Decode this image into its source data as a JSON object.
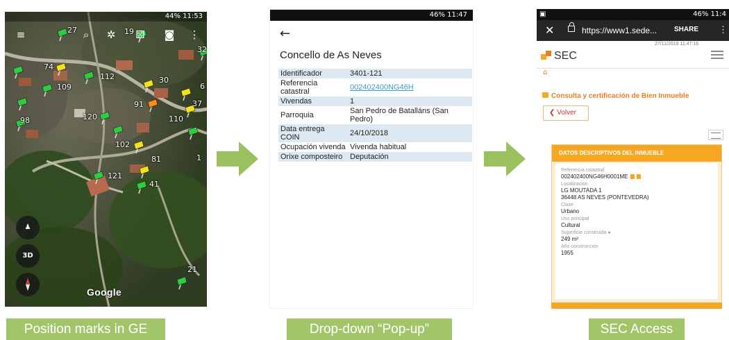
{
  "panel_ge": {
    "status": "44% 11:53",
    "pin_labels": [
      "27",
      "19",
      "32",
      "74",
      "112",
      "109",
      "30",
      "91",
      "37",
      "110",
      "98",
      "120",
      "102",
      "81",
      "121",
      "41",
      "21",
      "1",
      "6"
    ],
    "btn_3d": "3D",
    "watermark": "Google",
    "caption": "Position marks in GE"
  },
  "panel_popup": {
    "status": "46% 11:47",
    "title": "Concello de As Neves",
    "rows": [
      {
        "key": "Identificador",
        "value": "3401-121"
      },
      {
        "key": "Referencia catastral",
        "value": "002402400NG46H"
      },
      {
        "key": "Vivendas",
        "value": "1"
      },
      {
        "key": "Parroquia",
        "value": "San Pedro de Batalláns (San Pedro)"
      },
      {
        "key": "Data entrega COIN",
        "value": "24/10/2018"
      },
      {
        "key": "Ocupación vivenda",
        "value": "Vivenda habitual"
      },
      {
        "key": "Orixe composteiro",
        "value": "Deputación"
      }
    ],
    "caption": "Drop-down “Pop-up”"
  },
  "panel_sec": {
    "status": "46% 11:4",
    "url": "https://www1.sede...",
    "share": "SHARE",
    "timestamp": "27/11/2018 11:47:16",
    "brand": "SEC",
    "heading": "Consulta y certificación de Bien Inmueble",
    "back": "Volver",
    "card_title": "DATOS DESCRIPTIVOS DEL INMUEBLE",
    "ref_label": "Referencia catastral",
    "ref_value": "002402400NG46H0001ME",
    "loc_label": "Localización",
    "loc_line1": "LG MOUTADA 1",
    "loc_line2": "36448 AS NEVES (PONTEVEDRA)",
    "clase_label": "Clase",
    "clase_value": "Urbano",
    "uso_label": "Uso principal",
    "uso_value": "Cultural",
    "sup_label": "Superficie construida",
    "sup_value": "249 m²",
    "ano_label": "Año construcción",
    "ano_value": "1955",
    "caption": "SEC Access"
  },
  "colors": {
    "arrow": "#9bc15f",
    "caption_bg": "#a3c569",
    "sec_orange": "#f5a623",
    "pin_green": "#2ecc40",
    "pin_yellow": "#f1e21a",
    "pin_orange": "#ff8a1c"
  }
}
